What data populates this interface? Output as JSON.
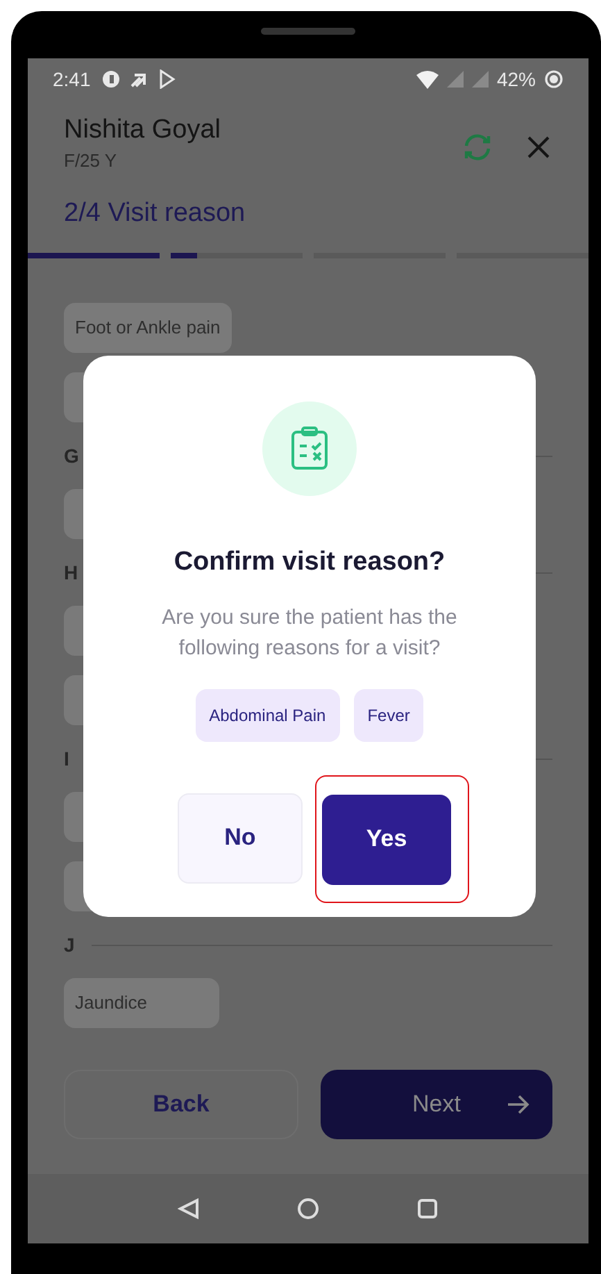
{
  "status_bar": {
    "time": "2:41",
    "battery": "42%"
  },
  "patient": {
    "name": "Nishita Goyal",
    "details": "F/25 Y"
  },
  "step": {
    "title": "2/4 Visit reason",
    "segments": [
      {
        "level": 1
      },
      {
        "level": 0.2
      },
      {
        "level": 0
      },
      {
        "level": 0
      }
    ]
  },
  "reason_list": [
    {
      "kind": "chip",
      "label": "Foot or Ankle pain"
    },
    {
      "kind": "chip"
    },
    {
      "kind": "letter",
      "label": "G"
    },
    {
      "kind": "chip"
    },
    {
      "kind": "letter",
      "label": "H"
    },
    {
      "kind": "chip"
    },
    {
      "kind": "chip"
    },
    {
      "kind": "letter",
      "label": "I"
    },
    {
      "kind": "chip"
    },
    {
      "kind": "chip"
    },
    {
      "kind": "letter",
      "label": "J"
    },
    {
      "kind": "chip",
      "label": "Jaundice"
    }
  ],
  "footer": {
    "back": "Back",
    "next": "Next"
  },
  "dialog": {
    "title": "Confirm visit reason?",
    "message": "Are you sure the patient has the following reasons for a visit?",
    "reasons": [
      "Abdominal Pain",
      "Fever"
    ],
    "buttons": [
      {
        "label": "No",
        "kind": "secondary",
        "highlighted": false
      },
      {
        "label": "Yes",
        "kind": "primary",
        "highlighted": true
      }
    ]
  }
}
